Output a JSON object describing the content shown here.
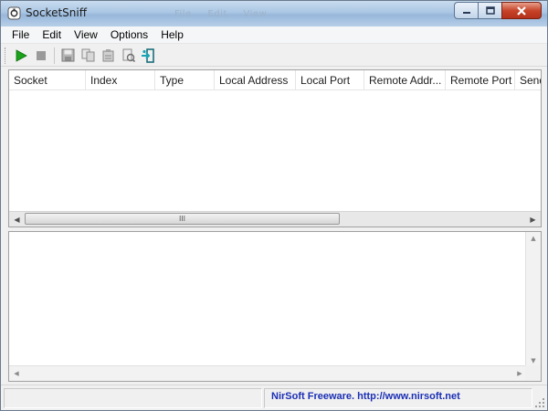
{
  "window": {
    "title": "SocketSniff",
    "ghost_menu": [
      "File",
      "Edit",
      "View"
    ]
  },
  "menu": [
    "File",
    "Edit",
    "View",
    "Options",
    "Help"
  ],
  "toolbar": [
    {
      "name": "start-capture-icon"
    },
    {
      "name": "stop-capture-icon"
    },
    {
      "name": "save-icon"
    },
    {
      "name": "copy-icon"
    },
    {
      "name": "properties-icon"
    },
    {
      "name": "html-report-icon"
    },
    {
      "name": "exit-icon"
    }
  ],
  "columns": [
    "Socket",
    "Index",
    "Type",
    "Local Address",
    "Local Port",
    "Remote Addr...",
    "Remote Port",
    "Send"
  ],
  "hscroll": {
    "thumb_label": "III"
  },
  "status": {
    "text": "NirSoft Freeware.  http://www.nirsoft.net"
  },
  "colors": {
    "status_link": "#1b2fb5",
    "title_bar": "#a9c6e4",
    "close_button": "#c7442a"
  }
}
